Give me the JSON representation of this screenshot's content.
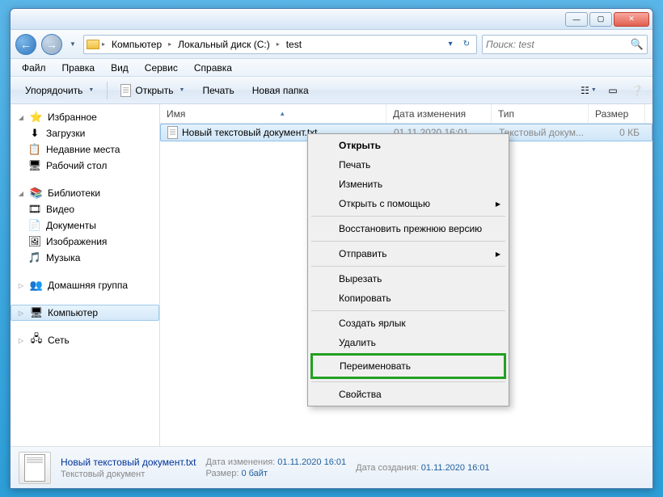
{
  "titlebar": {
    "min": "—",
    "max": "▢",
    "close": "✕"
  },
  "nav": {
    "back": "←",
    "fwd": "→",
    "drop": "▼",
    "refresh": "↻"
  },
  "breadcrumbs": [
    "Компьютер",
    "Локальный диск (C:)",
    "test"
  ],
  "search": {
    "placeholder": "Поиск: test",
    "icon": "🔍"
  },
  "menu": [
    "Файл",
    "Правка",
    "Вид",
    "Сервис",
    "Справка"
  ],
  "toolbar": {
    "organize": "Упорядочить",
    "open": "Открыть",
    "print": "Печать",
    "newfolder": "Новая папка"
  },
  "sidebar": {
    "favorites": {
      "label": "Избранное",
      "items": [
        {
          "icon": "⬇",
          "label": "Загрузки"
        },
        {
          "icon": "📋",
          "label": "Недавние места"
        },
        {
          "icon": "🖥",
          "label": "Рабочий стол"
        }
      ]
    },
    "libraries": {
      "label": "Библиотеки",
      "items": [
        {
          "icon": "🎞",
          "label": "Видео"
        },
        {
          "icon": "📄",
          "label": "Документы"
        },
        {
          "icon": "🖼",
          "label": "Изображения"
        },
        {
          "icon": "🎵",
          "label": "Музыка"
        }
      ]
    },
    "homegroup": {
      "icon": "👥",
      "label": "Домашняя группа"
    },
    "computer": {
      "icon": "🖥",
      "label": "Компьютер"
    },
    "network": {
      "icon": "🖧",
      "label": "Сеть"
    }
  },
  "columns": {
    "name": "Имя",
    "date": "Дата изменения",
    "type": "Тип",
    "size": "Размер"
  },
  "files": [
    {
      "name": "Новый текстовый документ.txt",
      "date": "01.11.2020 16:01",
      "type": "Текстовый докум...",
      "size": "0 КБ"
    }
  ],
  "context": {
    "open": "Открыть",
    "print": "Печать",
    "edit": "Изменить",
    "openwith": "Открыть с помощью",
    "restore": "Восстановить прежнюю версию",
    "sendto": "Отправить",
    "cut": "Вырезать",
    "copy": "Копировать",
    "shortcut": "Создать ярлык",
    "delete": "Удалить",
    "rename": "Переименовать",
    "properties": "Свойства"
  },
  "details": {
    "name": "Новый текстовый документ.txt",
    "type": "Текстовый документ",
    "modified_label": "Дата изменения:",
    "modified": "01.11.2020 16:01",
    "size_label": "Размер:",
    "size": "0 байт",
    "created_label": "Дата создания:",
    "created": "01.11.2020 16:01"
  }
}
